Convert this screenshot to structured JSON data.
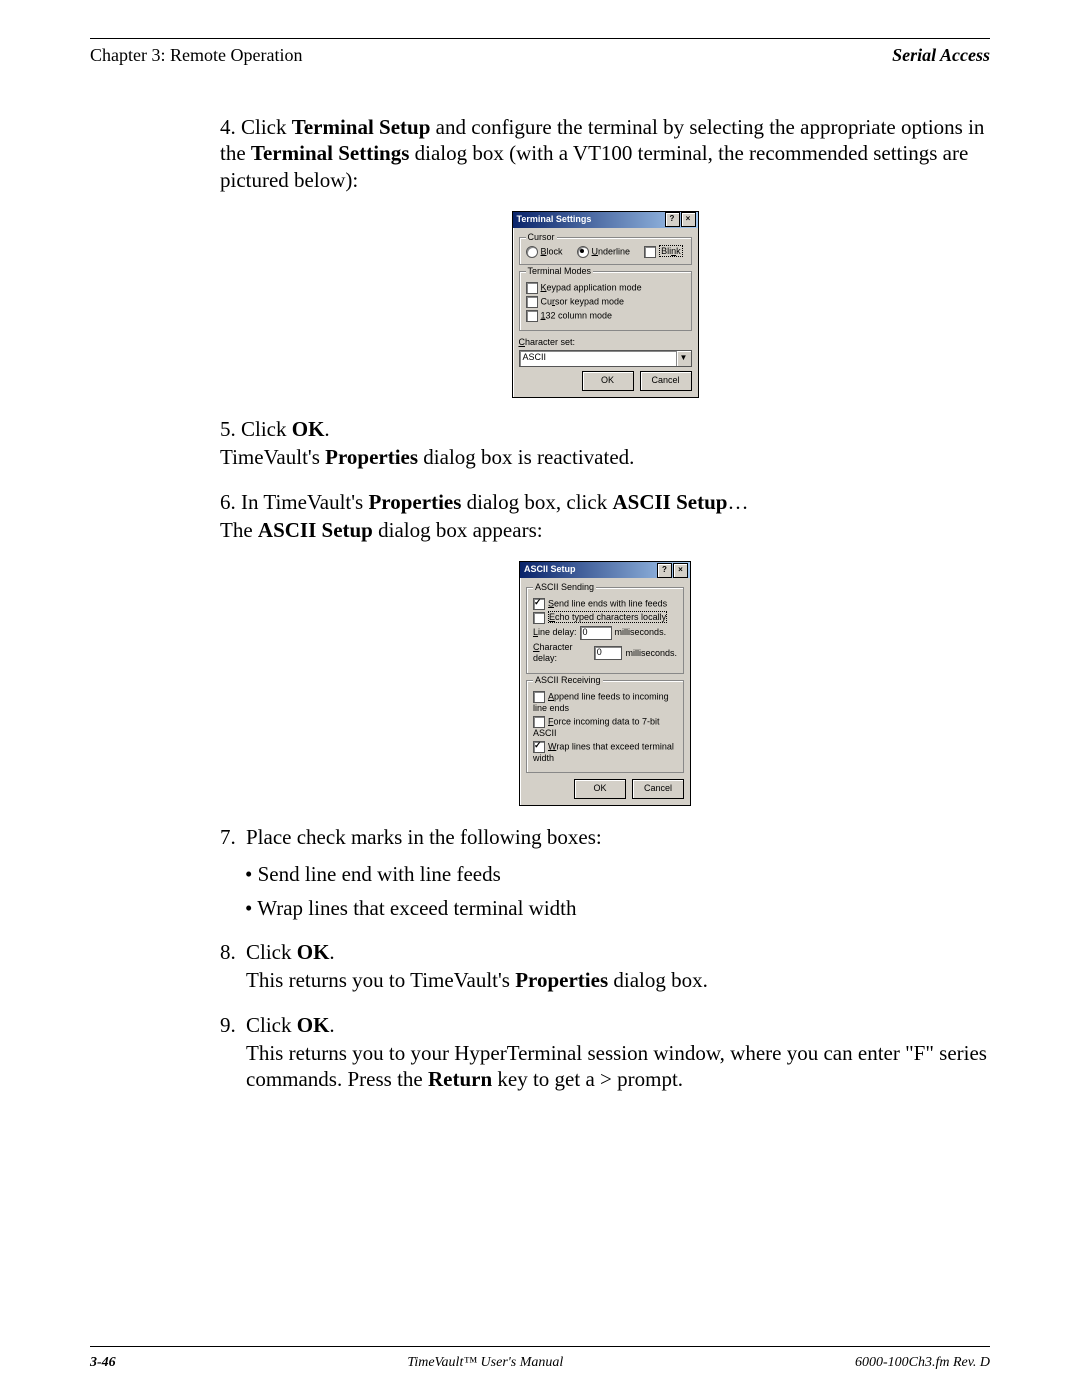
{
  "header": {
    "left": "Chapter 3: Remote Operation",
    "right": "Serial Access"
  },
  "steps": {
    "s4_num": "4.",
    "s4_a": "Click ",
    "s4_b": "Terminal Setup",
    "s4_c": " and configure the terminal by selecting the appropriate options in the ",
    "s4_d": "Terminal Settings",
    "s4_e": " dialog box (with a VT100 terminal, the recommended settings are pictured below):",
    "s5_num": "5.",
    "s5_a": "Click ",
    "s5_b": "OK",
    "s5_c": ".",
    "s5_d": "TimeVault's ",
    "s5_e": "Properties",
    "s5_f": " dialog box is reactivated.",
    "s6_num": "6.",
    "s6_a": "In TimeVault's ",
    "s6_b": "Properties",
    "s6_c": " dialog box, click ",
    "s6_d": "ASCII Setup",
    "s6_e": "…",
    "s6_f": "The ",
    "s6_g": "ASCII Setup",
    "s6_h": " dialog box appears:",
    "s7_num": "7.",
    "s7_a": "Place check marks in the following boxes:",
    "s7_bullets": [
      "Send line end with line feeds",
      "Wrap lines that exceed terminal width"
    ],
    "s8_num": "8.",
    "s8_a": "Click ",
    "s8_b": "OK",
    "s8_c": ".",
    "s8_d": "This returns you to TimeVault's ",
    "s8_e": "Properties",
    "s8_f": " dialog box.",
    "s9_num": "9.",
    "s9_a": "Click ",
    "s9_b": "OK",
    "s9_c": ".",
    "s9_d": "This returns you to your HyperTerminal session window, where you can enter \"F\" series commands. Press the ",
    "s9_e": "Return",
    "s9_f": " key to get a > prompt."
  },
  "dialog1": {
    "title": "Terminal Settings",
    "cursor_group": "Cursor",
    "cursor_block": "Block",
    "cursor_underline": "Underline",
    "cursor_blink": "Blink",
    "modes_group": "Terminal Modes",
    "mode1": "Keypad application mode",
    "mode2": "Cursor keypad mode",
    "mode3": "132 column mode",
    "charset_label": "Character set:",
    "charset_value": "ASCII",
    "ok": "OK",
    "cancel": "Cancel"
  },
  "dialog2": {
    "title": "ASCII Setup",
    "sending_group": "ASCII Sending",
    "send1": "Send line ends with line feeds",
    "send2": "Echo typed characters locally",
    "line_delay_label": "Line delay:",
    "line_delay_val": "0",
    "ms": "milliseconds.",
    "char_delay_label": "Character delay:",
    "char_delay_val": "0",
    "receiving_group": "ASCII Receiving",
    "recv1": "Append line feeds to incoming line ends",
    "recv2": "Force incoming data to 7-bit ASCII",
    "recv3": "Wrap lines that exceed terminal width",
    "ok": "OK",
    "cancel": "Cancel"
  },
  "footer": {
    "page": "3-46",
    "center": "TimeVault™ User's Manual",
    "right": "6000-100Ch3.fm  Rev. D"
  }
}
